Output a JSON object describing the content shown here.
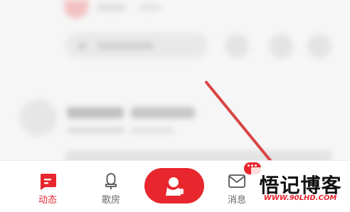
{
  "colors": {
    "accent": "#e8262d",
    "muted": "#666666"
  },
  "tabs": [
    {
      "label": "动态",
      "icon": "message-square-icon",
      "active": true
    },
    {
      "label": "歌房",
      "icon": "microphone-icon",
      "active": false
    },
    {
      "label": "",
      "icon": "publish-icon",
      "active": false
    },
    {
      "label": "消息",
      "icon": "envelope-icon",
      "active": false
    }
  ],
  "badge": {
    "text": "•••"
  },
  "watermark": {
    "title": "悟记博客",
    "url": "WWW.90LHD.COM"
  }
}
